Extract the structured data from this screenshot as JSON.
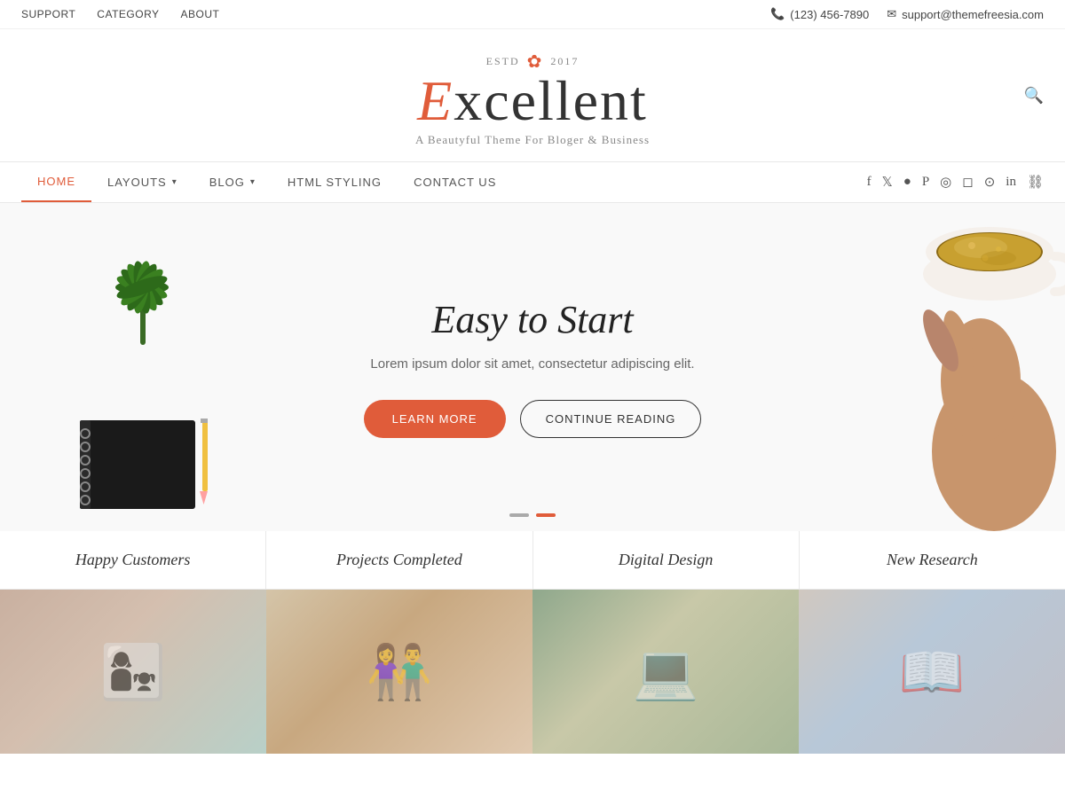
{
  "topbar": {
    "nav_links": [
      {
        "label": "SUPPORT",
        "href": "#"
      },
      {
        "label": "CATEGORY",
        "href": "#"
      },
      {
        "label": "ABOUT",
        "href": "#"
      }
    ],
    "phone": "(123) 456-7890",
    "email": "support@themefreesia.com"
  },
  "logo": {
    "estd": "ESTD",
    "year": "2017",
    "title_prefix": "E",
    "title_rest": "xcellent",
    "subtitle": "A Beautyful Theme For Bloger & Business"
  },
  "nav": {
    "links": [
      {
        "label": "HOME",
        "active": true
      },
      {
        "label": "LAYOUTS",
        "has_dropdown": true
      },
      {
        "label": "BLOG",
        "has_dropdown": true
      },
      {
        "label": "HTML STYLING",
        "has_dropdown": false
      },
      {
        "label": "CONTACT US",
        "has_dropdown": false
      }
    ],
    "social_icons": [
      "facebook",
      "twitter",
      "circle",
      "pinterest",
      "dribbble",
      "instagram",
      "flickr",
      "linkedin",
      "link"
    ]
  },
  "hero": {
    "title": "Easy to Start",
    "description": "Lorem ipsum dolor sit amet, consectetur adipiscing elit.",
    "btn_learn_more": "LEARN MORE",
    "btn_continue": "CONTINUE READING",
    "dots": [
      {
        "active": false
      },
      {
        "active": true
      }
    ]
  },
  "stats": [
    {
      "label": "Happy Customers"
    },
    {
      "label": "Projects Completed"
    },
    {
      "label": "Digital Design"
    },
    {
      "label": "New Research"
    }
  ],
  "images": [
    {
      "alt": "Family photo",
      "css_class": "img-family"
    },
    {
      "alt": "Couple photo",
      "css_class": "img-couple"
    },
    {
      "alt": "Desk photo",
      "css_class": "img-desk"
    },
    {
      "alt": "Reading photo",
      "css_class": "img-reading"
    }
  ]
}
